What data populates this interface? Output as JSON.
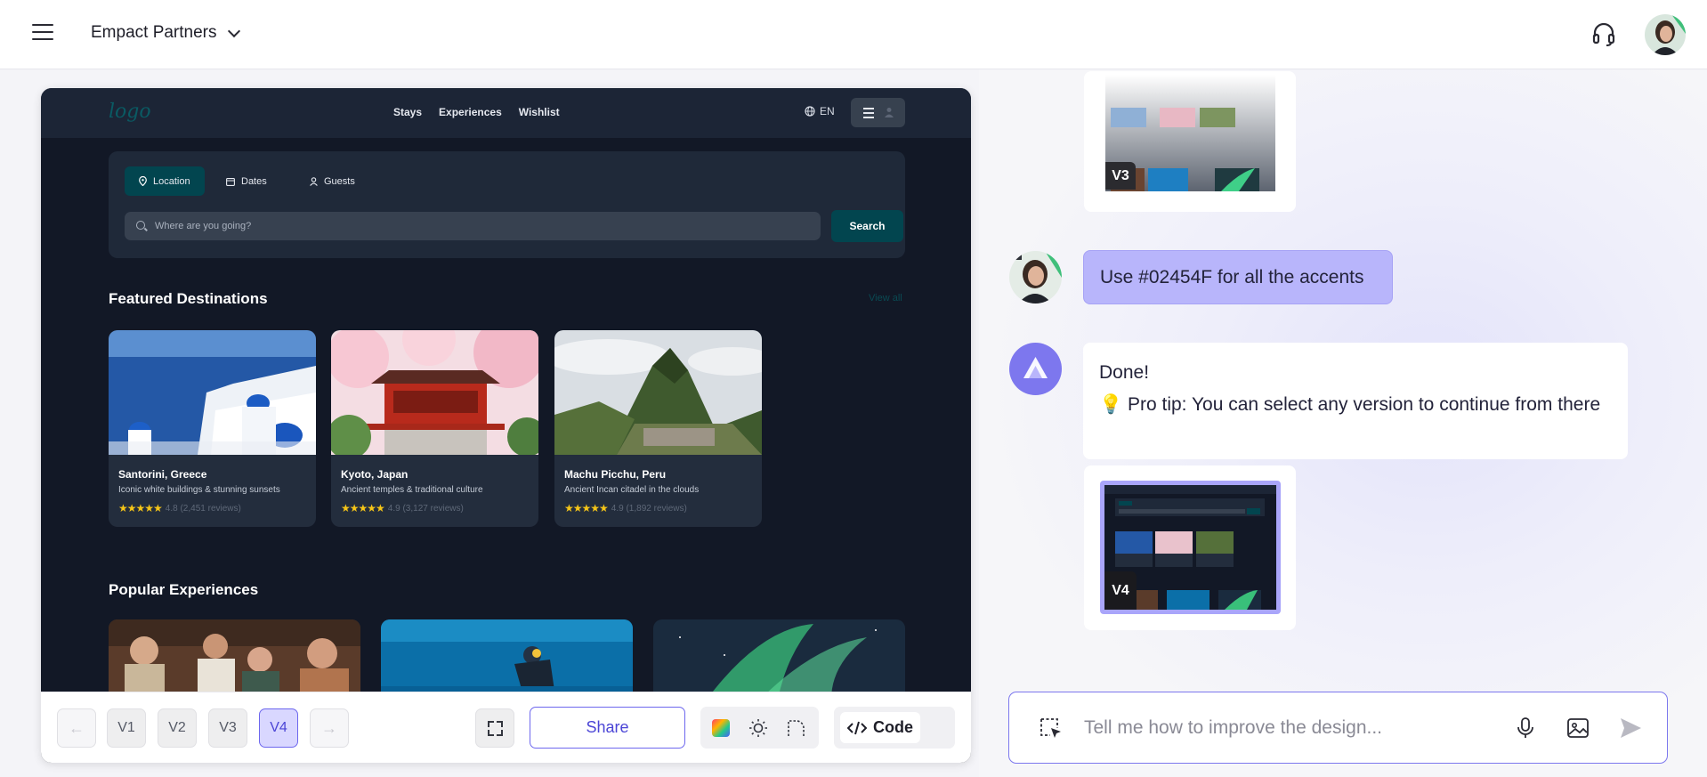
{
  "header": {
    "workspace_name": "Empact Partners",
    "menu_icon": "hamburger-menu-icon",
    "support_icon": "headset-icon"
  },
  "preview": {
    "nav": {
      "logo": "logo",
      "links": [
        "Stays",
        "Experiences",
        "Wishlist"
      ],
      "language": "EN"
    },
    "search": {
      "tabs": [
        "Location",
        "Dates",
        "Guests"
      ],
      "active_tab": "Location",
      "placeholder": "Where are you going?",
      "button_label": "Search"
    },
    "featured": {
      "title": "Featured Destinations",
      "view_all": "View all",
      "cards": [
        {
          "name": "Santorini, Greece",
          "desc": "Iconic white buildings & stunning sunsets",
          "stars": "★★★★★",
          "rating": "4.8 (2,451 reviews)"
        },
        {
          "name": "Kyoto, Japan",
          "desc": "Ancient temples & traditional culture",
          "stars": "★★★★★",
          "rating": "4.9 (3,127 reviews)"
        },
        {
          "name": "Machu Picchu, Peru",
          "desc": "Ancient Incan citadel in the clouds",
          "stars": "★★★★★",
          "rating": "4.9 (1,892 reviews)"
        }
      ]
    },
    "experiences": {
      "title": "Popular Experiences"
    },
    "accent_color": "#02454F"
  },
  "toolbar": {
    "versions": [
      "V1",
      "V2",
      "V3",
      "V4"
    ],
    "active_version": "V4",
    "share_label": "Share",
    "code_label": "Code",
    "prev_arrow": "←",
    "next_arrow": "→"
  },
  "chat": {
    "thumb_v3_label": "V3",
    "user_message": "Use #02454F for all the accents",
    "bot_line1": "Done!",
    "bot_line2": "💡 Pro tip: You can select any version to continue from there",
    "thumb_v4_label": "V4",
    "composer_placeholder": "Tell me how to improve the design..."
  },
  "colors": {
    "brand": "#6d67ee",
    "user_bubble": "#b8b5fb"
  }
}
